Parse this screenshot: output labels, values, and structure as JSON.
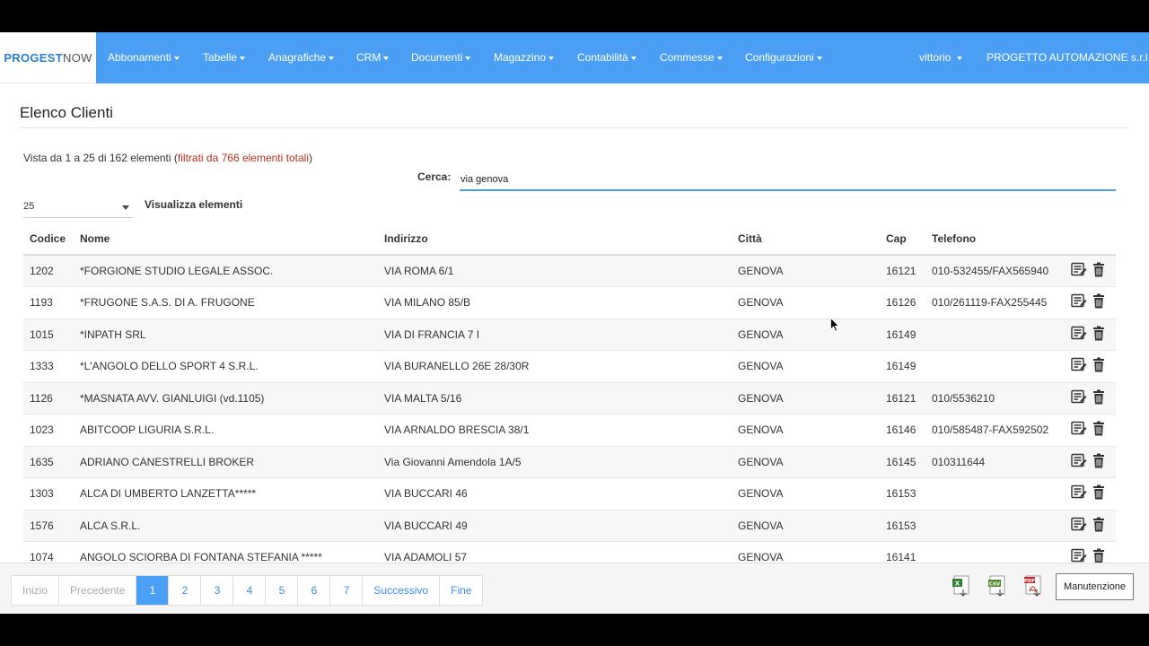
{
  "brand": {
    "part1": "PROGEST",
    "part2": "NOW"
  },
  "nav": {
    "items": [
      "Abbonamenti",
      "Tabelle",
      "Anagrafiche",
      "CRM",
      "Documenti",
      "Magazzino",
      "Contabilità",
      "Commesse",
      "Configurazioni"
    ],
    "user": "vittorio",
    "company": "PROGETTO AUTOMAZIONE s.r.l."
  },
  "page": {
    "title": "Elenco Clienti",
    "info_main": "Vista da 1 a 25 di 162 elementi",
    "info_filtered": "filtrati da 766 elementi totali",
    "search_label": "Cerca:",
    "search_value": "via genova",
    "length_value": "25",
    "length_label": "Visualizza elementi"
  },
  "table": {
    "headers": [
      "Codice",
      "Nome",
      "Indirizzo",
      "Città",
      "Cap",
      "Telefono"
    ],
    "rows": [
      [
        "1202",
        "*FORGIONE STUDIO LEGALE ASSOC.",
        "VIA ROMA 6/1",
        "GENOVA",
        "16121",
        "010-532455/FAX565940"
      ],
      [
        "1193",
        "*FRUGONE S.A.S. DI A. FRUGONE",
        "VIA MILANO 85/B",
        "GENOVA",
        "16126",
        "010/261119-FAX255445"
      ],
      [
        "1015",
        "*INPATH SRL",
        "VIA DI FRANCIA 7 I",
        "GENOVA",
        "16149",
        ""
      ],
      [
        "1333",
        "*L'ANGOLO DELLO SPORT 4 S.R.L.",
        "VIA BURANELLO 26E 28/30R",
        "GENOVA",
        "16149",
        ""
      ],
      [
        "1126",
        "*MASNATA AVV. GIANLUIGI (vd.1105)",
        "VIA MALTA 5/16",
        "GENOVA",
        "16121",
        "010/5536210"
      ],
      [
        "1023",
        "ABITCOOP LIGURIA S.R.L.",
        "VIA ARNALDO BRESCIA 38/1",
        "GENOVA",
        "16146",
        "010/585487-FAX592502"
      ],
      [
        "1635",
        "ADRIANO CANESTRELLI BROKER",
        "Via Giovanni Amendola 1A/5",
        "GENOVA",
        "16145",
        "010311644"
      ],
      [
        "1303",
        "ALCA DI UMBERTO LANZETTA*****",
        "VIA BUCCARI 46",
        "GENOVA",
        "16153",
        ""
      ],
      [
        "1576",
        "ALCA S.R.L.",
        "VIA BUCCARI 49",
        "GENOVA",
        "16153",
        ""
      ],
      [
        "1074",
        "ANGOLO SCIORBA DI FONTANA STEFANIA *****",
        "VIA ADAMOLI 57",
        "GENOVA",
        "16141",
        ""
      ]
    ]
  },
  "pagination": {
    "first": "Inizio",
    "prev": "Precedente",
    "pages": [
      "1",
      "2",
      "3",
      "4",
      "5",
      "6",
      "7"
    ],
    "active_page": "1",
    "next": "Successivo",
    "last": "Fine"
  },
  "export_icons": [
    "excel-export-icon",
    "csv-export-icon",
    "pdf-export-icon"
  ],
  "maintenance_button": "Manutenzione",
  "colors": {
    "navbar": "#4a9ff5",
    "accent": "#3a8ee6",
    "filtered_text": "#b03020"
  }
}
